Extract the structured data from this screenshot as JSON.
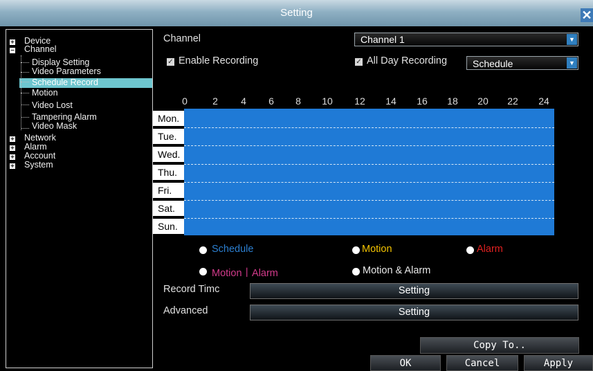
{
  "window": {
    "title": "Setting",
    "close_glyph": "✕"
  },
  "tree": {
    "expand_glyph": "+",
    "collapse_glyph": "−",
    "items": [
      {
        "label": "Device"
      },
      {
        "label": "Channel"
      },
      {
        "label": "Display Setting"
      },
      {
        "label": "Video Parameters"
      },
      {
        "label": "Schedule Record",
        "selected": true
      },
      {
        "label": "Motion"
      },
      {
        "label": "Video Lost"
      },
      {
        "label": "Tampering Alarm"
      },
      {
        "label": "Video Mask"
      },
      {
        "label": "Network"
      },
      {
        "label": "Alarm"
      },
      {
        "label": "Account"
      },
      {
        "label": "System"
      }
    ]
  },
  "channel": {
    "label": "Channel",
    "value": "Channel 1"
  },
  "enable_recording": {
    "label": "Enable Recording",
    "checked": true
  },
  "all_day_recording": {
    "label": "All Day Recording",
    "checked": true
  },
  "mode": {
    "value": "Schedule"
  },
  "check_glyph": "✓",
  "arrow_glyph": "▼",
  "schedule": {
    "hours": [
      "0",
      "2",
      "4",
      "6",
      "8",
      "10",
      "12",
      "14",
      "16",
      "18",
      "20",
      "22",
      "24"
    ],
    "days": [
      "Mon.",
      "Tue.",
      "Wed.",
      "Thu.",
      "Fri.",
      "Sat.",
      "Sun."
    ],
    "fill_color": "#1f7ad6"
  },
  "legend": [
    {
      "label": "Schedule",
      "color": "#2c7fd0"
    },
    {
      "label": "Motion",
      "color": "#f2c200"
    },
    {
      "label": "Alarm",
      "color": "#e02020"
    },
    {
      "label": "Motion丨Alarm",
      "color": "#d13a8a"
    },
    {
      "label": "Motion & Alarm",
      "color": "#e8e8e8"
    }
  ],
  "record_time": {
    "label": "Record Timc",
    "button": "Setting"
  },
  "advanced": {
    "label": "Advanced",
    "button": "Setting"
  },
  "buttons": {
    "copy_to": "Copy To..",
    "ok": "OK",
    "cancel": "Cancel",
    "apply": "Apply"
  }
}
